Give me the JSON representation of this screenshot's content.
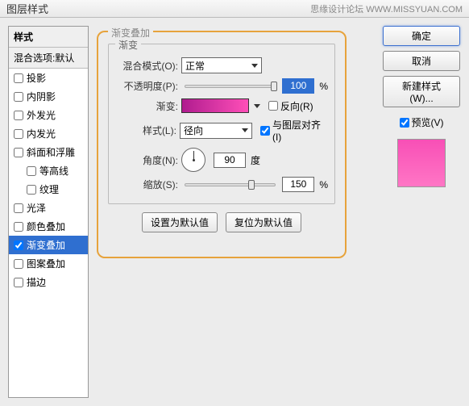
{
  "title": "图层样式",
  "subtitle": "思缘设计论坛  WWW.MISSYUAN.COM",
  "sidebar": {
    "styles_header": "样式",
    "blend_options": "混合选项:默认",
    "items": [
      {
        "label": "投影",
        "checked": false
      },
      {
        "label": "内阴影",
        "checked": false
      },
      {
        "label": "外发光",
        "checked": false
      },
      {
        "label": "内发光",
        "checked": false
      },
      {
        "label": "斜面和浮雕",
        "checked": false
      },
      {
        "label": "等高线",
        "checked": false,
        "indent": true
      },
      {
        "label": "纹理",
        "checked": false,
        "indent": true
      },
      {
        "label": "光泽",
        "checked": false
      },
      {
        "label": "颜色叠加",
        "checked": false
      },
      {
        "label": "渐变叠加",
        "checked": true,
        "active": true
      },
      {
        "label": "图案叠加",
        "checked": false
      },
      {
        "label": "描边",
        "checked": false
      }
    ]
  },
  "panel": {
    "title": "渐变叠加",
    "gradient_legend": "渐变",
    "blend_mode_label": "混合模式(O):",
    "blend_mode_value": "正常",
    "opacity_label": "不透明度(P):",
    "opacity_value": "100",
    "opacity_unit": "%",
    "gradient_label": "渐变:",
    "reverse_label": "反向(R)",
    "style_label": "样式(L):",
    "style_value": "径向",
    "align_label": "与图层对齐(I)",
    "angle_label": "角度(N):",
    "angle_value": "90",
    "angle_unit": "度",
    "scale_label": "缩放(S):",
    "scale_value": "150",
    "scale_unit": "%",
    "set_default": "设置为默认值",
    "reset_default": "复位为默认值"
  },
  "right": {
    "ok": "确定",
    "cancel": "取消",
    "new_style": "新建样式(W)...",
    "preview": "预览(V)"
  }
}
